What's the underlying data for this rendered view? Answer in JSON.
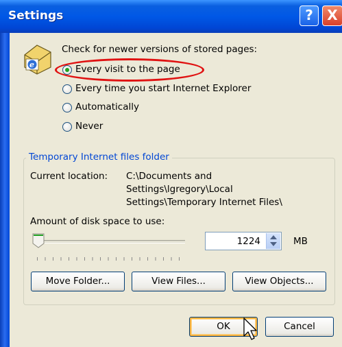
{
  "window": {
    "title": "Settings"
  },
  "titlebar_buttons": {
    "help": "?",
    "close": "X"
  },
  "check_heading": "Check for newer versions of stored pages:",
  "radios": [
    {
      "label": "Every visit to the page",
      "selected": true
    },
    {
      "label": "Every time you start Internet Explorer",
      "selected": false
    },
    {
      "label": "Automatically",
      "selected": false
    },
    {
      "label": "Never",
      "selected": false
    }
  ],
  "temp_files": {
    "group_title": "Temporary Internet files folder",
    "location_label": "Current location:",
    "location_lines": [
      "C:\\Documents and",
      "Settings\\lgregory\\Local",
      "Settings\\Temporary Internet Files\\"
    ],
    "disk_label": "Amount of disk space to use:",
    "disk_value": "1224",
    "unit": "MB",
    "slider_level": 0.02,
    "move_folder": "Move Folder...",
    "view_files": "View Files...",
    "view_objects": "View Objects..."
  },
  "footer": {
    "ok": "OK",
    "cancel": "Cancel"
  },
  "colors": {
    "titlebar": "#0058e6",
    "dialog_bg": "#ece9d8",
    "highlight": "#e01212",
    "group_title": "#0046d5",
    "radio_dot": "#21a121"
  },
  "icons": [
    "ie-cache-icon",
    "help-icon",
    "close-icon",
    "mouse-pointer-icon"
  ]
}
